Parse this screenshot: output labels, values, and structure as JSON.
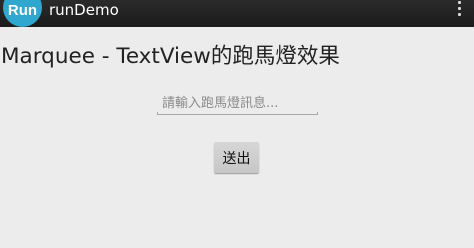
{
  "action_bar": {
    "icon_text": "Run",
    "title": "runDemo",
    "background": "#222222",
    "icon_color": "#2fa7cf"
  },
  "main": {
    "marquee_text": "Marquee - TextView的跑馬燈效果",
    "input": {
      "value": "",
      "placeholder": "請輸入跑馬燈訊息..."
    },
    "send_button_label": "送出"
  },
  "icons": {
    "overflow": "overflow-menu-icon"
  }
}
